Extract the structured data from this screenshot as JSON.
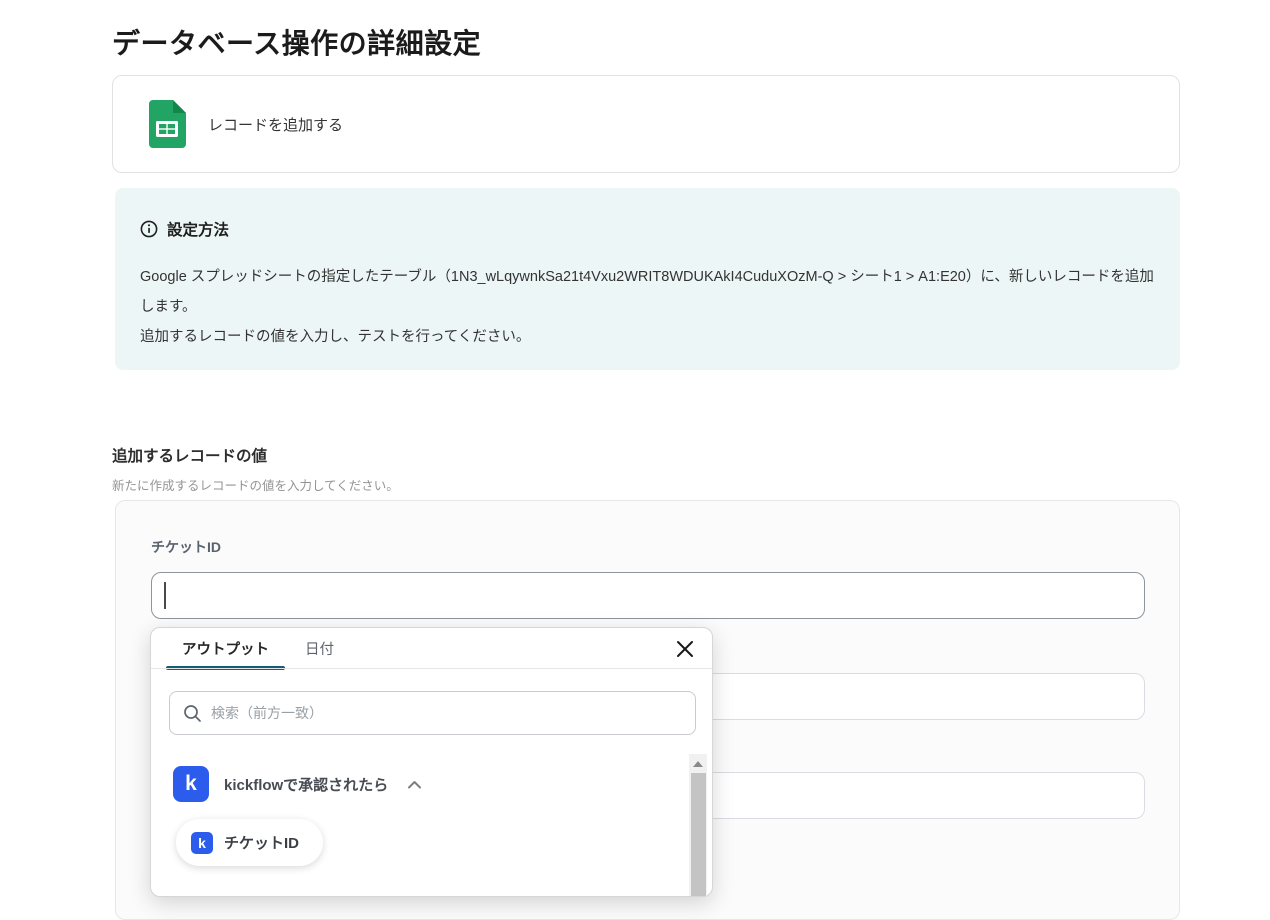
{
  "page": {
    "title": "データベース操作の詳細設定"
  },
  "action_card": {
    "label": "レコードを追加する",
    "icon": "google-sheets-icon"
  },
  "info_box": {
    "heading": "設定方法",
    "body_line1": "Google スプレッドシートの指定したテーブル（1N3_wLqywnkSa21t4Vxu2WRIT8WDUKAkI4CuduXOzM-Q > シート1 > A1:E20）に、新しいレコードを追加します。",
    "body_line2": "追加するレコードの値を入力し、テストを行ってください。"
  },
  "record_section": {
    "heading": "追加するレコードの値",
    "description": "新たに作成するレコードの値を入力してください。",
    "fields": [
      {
        "label": "チケットID",
        "value": ""
      }
    ]
  },
  "output_popup": {
    "tabs": [
      {
        "label": "アウトプット",
        "active": true
      },
      {
        "label": "日付",
        "active": false
      }
    ],
    "close_icon": "close-icon",
    "search_placeholder": "検索（前方一致）",
    "group": {
      "icon": "kickflow-app-icon",
      "icon_letter": "k",
      "label": "kickflowで承認されたら",
      "expanded": true
    },
    "chips": [
      {
        "icon": "kickflow-app-icon",
        "icon_letter": "k",
        "label": "チケットID"
      }
    ]
  },
  "colors": {
    "accent_teal": "#115e75",
    "kickflow_blue": "#2c5cec",
    "sheets_green": "#21a464",
    "sheets_green_dark": "#13864b",
    "info_box_bg": "#edf6f6"
  }
}
